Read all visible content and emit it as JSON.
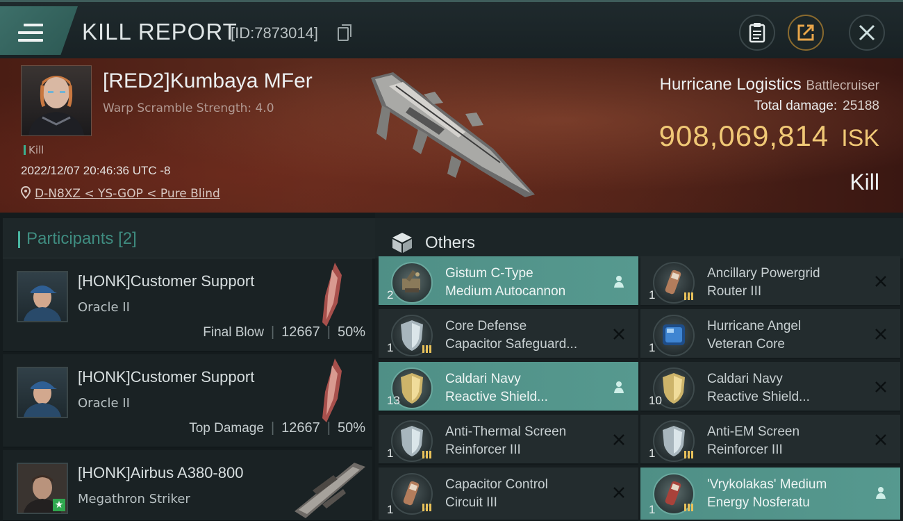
{
  "header": {
    "title": "KILL REPORT",
    "id_text": "[ID:7873014]"
  },
  "victim": {
    "name": "[RED2]Kumbaya MFer",
    "warp_scramble": "Warp Scramble Strength: 4.0",
    "kill_tag": "Kill",
    "datetime": "2022/12/07 20:46:36 UTC -8",
    "location": "D-N8XZ < YS-GOP < Pure Blind",
    "ship_name": "Hurricane Logistics",
    "ship_class": "Battlecruiser",
    "total_damage_label": "Total damage:",
    "total_damage": "25188",
    "isk_value": "908,069,814",
    "isk_unit": "ISK",
    "result": "Kill"
  },
  "participants": {
    "label": "Participants",
    "count": "[2]",
    "rows": [
      {
        "name": "[HONK]Customer Support",
        "ship": "Oracle II",
        "tag": "Final Blow",
        "damage": "12667",
        "percent": "50%"
      },
      {
        "name": "[HONK]Customer Support",
        "ship": "Oracle II",
        "tag": "Top Damage",
        "damage": "12667",
        "percent": "50%"
      },
      {
        "name": "[HONK]Airbus A380-800",
        "ship": "Megathron Striker",
        "tag": "",
        "damage": "",
        "percent": ""
      }
    ]
  },
  "others": {
    "title": "Others",
    "items": [
      {
        "line1": "Gistum C-Type",
        "line2": "Medium Autocannon",
        "qty": "2",
        "highlighted": true
      },
      {
        "line1": "Ancillary Powergrid",
        "line2": "Router III",
        "qty": "1",
        "highlighted": false
      },
      {
        "line1": "Core Defense",
        "line2": "Capacitor Safeguard...",
        "qty": "1",
        "highlighted": false
      },
      {
        "line1": "Hurricane Angel",
        "line2": "Veteran Core",
        "qty": "1",
        "highlighted": false
      },
      {
        "line1": "Caldari Navy",
        "line2": "Reactive Shield...",
        "qty": "13",
        "highlighted": true
      },
      {
        "line1": "Caldari Navy",
        "line2": "Reactive Shield...",
        "qty": "10",
        "highlighted": false
      },
      {
        "line1": "Anti-Thermal Screen",
        "line2": "Reinforcer III",
        "qty": "1",
        "highlighted": false
      },
      {
        "line1": "Anti-EM Screen",
        "line2": "Reinforcer III",
        "qty": "1",
        "highlighted": false
      },
      {
        "line1": "Capacitor Control",
        "line2": "Circuit III",
        "qty": "1",
        "highlighted": false
      },
      {
        "line1": "'Vrykolakas' Medium",
        "line2": "Energy Nosferatu",
        "qty": "1",
        "highlighted": true
      }
    ]
  },
  "colors": {
    "accent": "#4ab6a2",
    "isk": "#f0c876",
    "highlight_row": "#56998f",
    "banner": "#5c2a1d"
  }
}
